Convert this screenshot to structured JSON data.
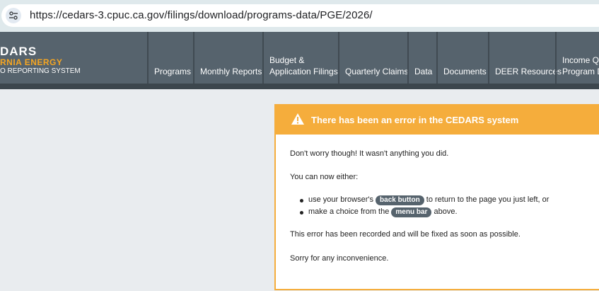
{
  "browser": {
    "url": "https://cedars-3.cpuc.ca.gov/filings/download/programs-data/PGE/2026/"
  },
  "logo": {
    "line1": "DARS",
    "line2": "RNIA ENERGY",
    "line3": "O REPORTING SYSTEM"
  },
  "nav": {
    "programs": "Programs",
    "monthly_reports": "Monthly Reports",
    "budget_line1": "Budget &",
    "budget_line2": "Application Filings",
    "quarterly_claims": "Quarterly Claims",
    "data": "Data",
    "documents": "Documents",
    "deer_resources": "DEER Resources",
    "income_line1": "Income Qu",
    "income_line2": "Program D"
  },
  "error_panel": {
    "title": "There has been an error in the CEDARS system",
    "p1": "Don't worry though! It wasn't anything you did.",
    "p2": "You can now either:",
    "li1_pre": "use your browser's",
    "li1_tag": "back button",
    "li1_post": "to return to the page you just left, or",
    "li2_pre": "make a choice from the",
    "li2_tag": "menu bar",
    "li2_post": "above.",
    "p3": "This error has been recorded and will be fixed as soon as possible.",
    "p4": "Sorry for any inconvenience."
  },
  "colors": {
    "header": "#56636d",
    "accent": "#f5ad3c",
    "logo_orange": "#f5a623"
  }
}
